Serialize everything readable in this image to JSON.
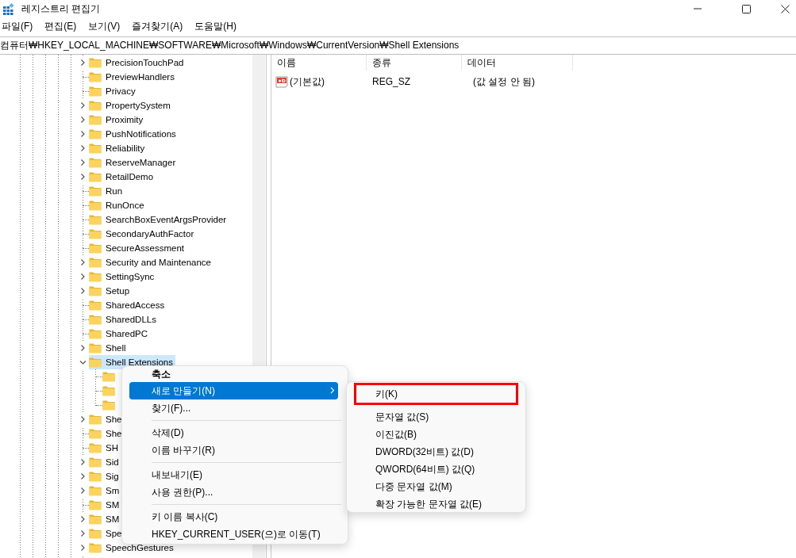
{
  "window": {
    "title": "레지스트리 편집기"
  },
  "menu_bar": [
    "파일(F)",
    "편집(E)",
    "보기(V)",
    "즐겨찾기(A)",
    "도움말(H)"
  ],
  "address_bar": {
    "path": "컴퓨터₩HKEY_LOCAL_MACHINE₩SOFTWARE₩Microsoft₩Windows₩CurrentVersion₩Shell Extensions"
  },
  "tree": {
    "items": [
      {
        "label": "PrecisionTouchPad",
        "kind": "collapsed",
        "selected": false
      },
      {
        "label": "PreviewHandlers",
        "kind": "leaf",
        "selected": false
      },
      {
        "label": "Privacy",
        "kind": "leaf",
        "selected": false
      },
      {
        "label": "PropertySystem",
        "kind": "collapsed",
        "selected": false
      },
      {
        "label": "Proximity",
        "kind": "collapsed",
        "selected": false
      },
      {
        "label": "PushNotifications",
        "kind": "collapsed",
        "selected": false
      },
      {
        "label": "Reliability",
        "kind": "collapsed",
        "selected": false
      },
      {
        "label": "ReserveManager",
        "kind": "collapsed",
        "selected": false
      },
      {
        "label": "RetailDemo",
        "kind": "collapsed",
        "selected": false
      },
      {
        "label": "Run",
        "kind": "leaf",
        "selected": false
      },
      {
        "label": "RunOnce",
        "kind": "leaf",
        "selected": false
      },
      {
        "label": "SearchBoxEventArgsProvider",
        "kind": "leaf",
        "selected": false
      },
      {
        "label": "SecondaryAuthFactor",
        "kind": "leaf",
        "selected": false
      },
      {
        "label": "SecureAssessment",
        "kind": "leaf",
        "selected": false
      },
      {
        "label": "Security and Maintenance",
        "kind": "collapsed",
        "selected": false
      },
      {
        "label": "SettingSync",
        "kind": "collapsed",
        "selected": false
      },
      {
        "label": "Setup",
        "kind": "collapsed",
        "selected": false
      },
      {
        "label": "SharedAccess",
        "kind": "leaf",
        "selected": false
      },
      {
        "label": "SharedDLLs",
        "kind": "leaf",
        "selected": false
      },
      {
        "label": "SharedPC",
        "kind": "leaf",
        "selected": false
      },
      {
        "label": "Shell",
        "kind": "collapsed",
        "selected": false
      },
      {
        "label": "Shell Extensions",
        "kind": "expanded",
        "selected": true,
        "children": [
          {
            "kind": "leaf",
            "selected": false
          },
          {
            "kind": "leaf",
            "selected": false
          },
          {
            "kind": "leaf",
            "selected": false
          }
        ]
      },
      {
        "label": "She",
        "kind": "collapsed",
        "selected": false
      },
      {
        "label": "She",
        "kind": "leaf",
        "selected": false
      },
      {
        "label": "SH",
        "kind": "leaf",
        "selected": false
      },
      {
        "label": "Sid",
        "kind": "collapsed",
        "selected": false
      },
      {
        "label": "Sig",
        "kind": "collapsed",
        "selected": false
      },
      {
        "label": "Sm",
        "kind": "collapsed",
        "selected": false
      },
      {
        "label": "SM",
        "kind": "leaf",
        "selected": false
      },
      {
        "label": "SM",
        "kind": "collapsed",
        "selected": false
      },
      {
        "label": "Spe",
        "kind": "collapsed",
        "selected": false
      },
      {
        "label": "SpeechGestures",
        "kind": "collapsed",
        "selected": false
      }
    ]
  },
  "values": {
    "columns": [
      "이름",
      "종류",
      "데이터"
    ],
    "rows": [
      {
        "name": "(기본값)",
        "type": "REG_SZ",
        "data": "(값 설정 안 됨)"
      }
    ]
  },
  "context_menu": {
    "items": [
      {
        "kind": "item",
        "label": "축소",
        "bold": true,
        "selected": false
      },
      {
        "kind": "item",
        "label": "새로 만들기(N)",
        "bold": false,
        "selected": true,
        "submenu": true
      },
      {
        "kind": "item",
        "label": "찾기(F)...",
        "bold": false,
        "selected": false
      },
      {
        "kind": "separator"
      },
      {
        "kind": "item",
        "label": "삭제(D)",
        "bold": false,
        "selected": false
      },
      {
        "kind": "item",
        "label": "이름 바꾸기(R)",
        "bold": false,
        "selected": false
      },
      {
        "kind": "separator"
      },
      {
        "kind": "item",
        "label": "내보내기(E)",
        "bold": false,
        "selected": false
      },
      {
        "kind": "item",
        "label": "사용 권한(P)...",
        "bold": false,
        "selected": false
      },
      {
        "kind": "separator"
      },
      {
        "kind": "item",
        "label": "키 이름 복사(C)",
        "bold": false,
        "selected": false
      },
      {
        "kind": "item",
        "label": "HKEY_CURRENT_USER(으)로 이동(T)",
        "bold": false,
        "selected": false
      }
    ]
  },
  "submenu": {
    "items": [
      {
        "label": "키(K)",
        "annotated": true
      },
      {
        "label": "문자열 값(S)",
        "annotated": false
      },
      {
        "label": "이진값(B)",
        "annotated": false
      },
      {
        "label": "DWORD(32비트) 값(D)",
        "annotated": false
      },
      {
        "label": "QWORD(64비트) 값(Q)",
        "annotated": false
      },
      {
        "label": "다중 문자열 값(M)",
        "annotated": false
      },
      {
        "label": "확장 가능한 문자열 값(E)",
        "annotated": false
      }
    ]
  }
}
